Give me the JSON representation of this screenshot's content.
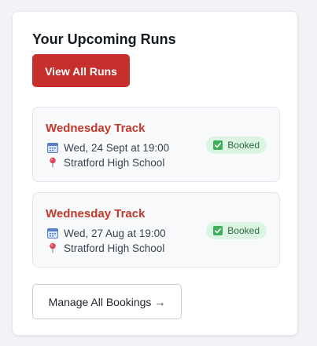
{
  "widget": {
    "title": "Your Upcoming Runs",
    "view_all_label": "View All Runs",
    "manage_label": "Manage All Bookings →"
  },
  "runs": [
    {
      "name": "Wednesday Track",
      "date": "Wed, 24 Sept at 19:00",
      "location": "Stratford High School",
      "status": "Booked"
    },
    {
      "name": "Wednesday Track",
      "date": "Wed, 27 Aug at 19:00",
      "location": "Stratford High School",
      "status": "Booked"
    }
  ],
  "icons": {
    "date": "calendar-icon",
    "location": "pin-icon",
    "status": "checkbox-icon"
  },
  "colors": {
    "accent": "#c5302c",
    "run_title": "#c0392b",
    "badge_bg": "#dcf5e3",
    "badge_text": "#2c6b3f"
  }
}
